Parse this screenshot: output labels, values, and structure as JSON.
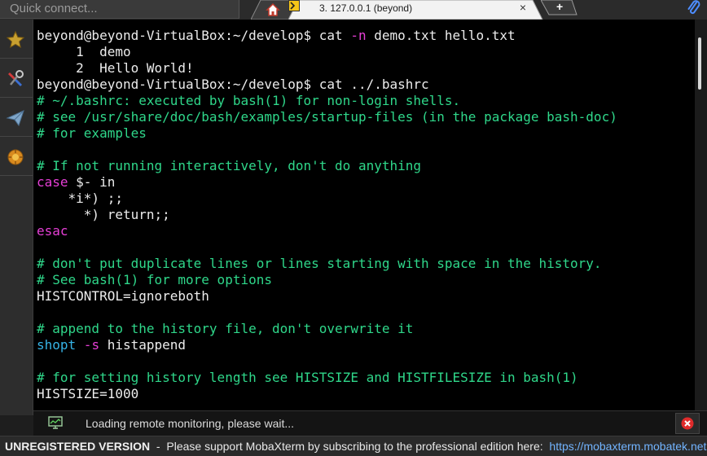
{
  "topbar": {
    "quick_connect_placeholder": "Quick connect...",
    "session_tab_label": "3. 127.0.0.1 (beyond)",
    "close_glyph": "×",
    "new_tab_glyph": "+"
  },
  "terminal": {
    "lines": [
      [
        {
          "t": "beyond@beyond-VirtualBox:~/develop$ cat ",
          "c": "white"
        },
        {
          "t": "-n",
          "c": "magenta"
        },
        {
          "t": " demo.txt hello.txt",
          "c": "white"
        }
      ],
      [
        {
          "t": "     1  demo",
          "c": "white"
        }
      ],
      [
        {
          "t": "     2  Hello World!",
          "c": "white"
        }
      ],
      [
        {
          "t": "beyond@beyond-VirtualBox:~/develop$ cat ../.bashrc",
          "c": "white"
        }
      ],
      [
        {
          "t": "# ~/.bashrc: executed by bash(1) for non-login shells.",
          "c": "green"
        }
      ],
      [
        {
          "t": "# see /usr/share/doc/bash/examples/startup-files (in the package bash-doc)",
          "c": "green"
        }
      ],
      [
        {
          "t": "# for examples",
          "c": "green"
        }
      ],
      [
        {
          "t": "",
          "c": "white"
        }
      ],
      [
        {
          "t": "# If not running interactively, don't do anything",
          "c": "green"
        }
      ],
      [
        {
          "t": "case",
          "c": "magenta"
        },
        {
          "t": " $- in",
          "c": "white"
        }
      ],
      [
        {
          "t": "    *i*) ;;",
          "c": "white"
        }
      ],
      [
        {
          "t": "      *) return;;",
          "c": "white"
        }
      ],
      [
        {
          "t": "esac",
          "c": "magenta"
        }
      ],
      [
        {
          "t": "",
          "c": "white"
        }
      ],
      [
        {
          "t": "# don't put duplicate lines or lines starting with space in the history.",
          "c": "green"
        }
      ],
      [
        {
          "t": "# See bash(1) for more options",
          "c": "green"
        }
      ],
      [
        {
          "t": "HISTCONTROL=ignoreboth",
          "c": "white"
        }
      ],
      [
        {
          "t": "",
          "c": "white"
        }
      ],
      [
        {
          "t": "# append to the history file, don't overwrite it",
          "c": "green"
        }
      ],
      [
        {
          "t": "shopt",
          "c": "cyan"
        },
        {
          "t": " -s",
          "c": "magenta"
        },
        {
          "t": " histappend",
          "c": "white"
        }
      ],
      [
        {
          "t": "",
          "c": "white"
        }
      ],
      [
        {
          "t": "# for setting history length see HISTSIZE and HISTFILESIZE in bash(1)",
          "c": "green"
        }
      ],
      [
        {
          "t": "HISTSIZE=1000",
          "c": "white"
        }
      ]
    ]
  },
  "notification": {
    "text": "Loading remote monitoring, please wait..."
  },
  "statusbar": {
    "unregistered": "UNREGISTERED VERSION",
    "separator": "  -  ",
    "message": "Please support MobaXterm by subscribing to the professional edition here:  ",
    "link": "https://mobaxterm.mobatek.net"
  },
  "colors": {
    "terminal_bg": "#000000",
    "text_white": "#ececec",
    "comment_green": "#2fd78a",
    "keyword_magenta": "#e63fd6",
    "builtin_cyan": "#36b3e6",
    "link_blue": "#72b4ff"
  },
  "icons": {
    "sidebar": [
      "star-icon",
      "tools-icon",
      "paper-plane-icon",
      "macro-icon"
    ],
    "topbar": [
      "home-icon",
      "terminal-tab-icon",
      "paperclip-icon"
    ]
  }
}
